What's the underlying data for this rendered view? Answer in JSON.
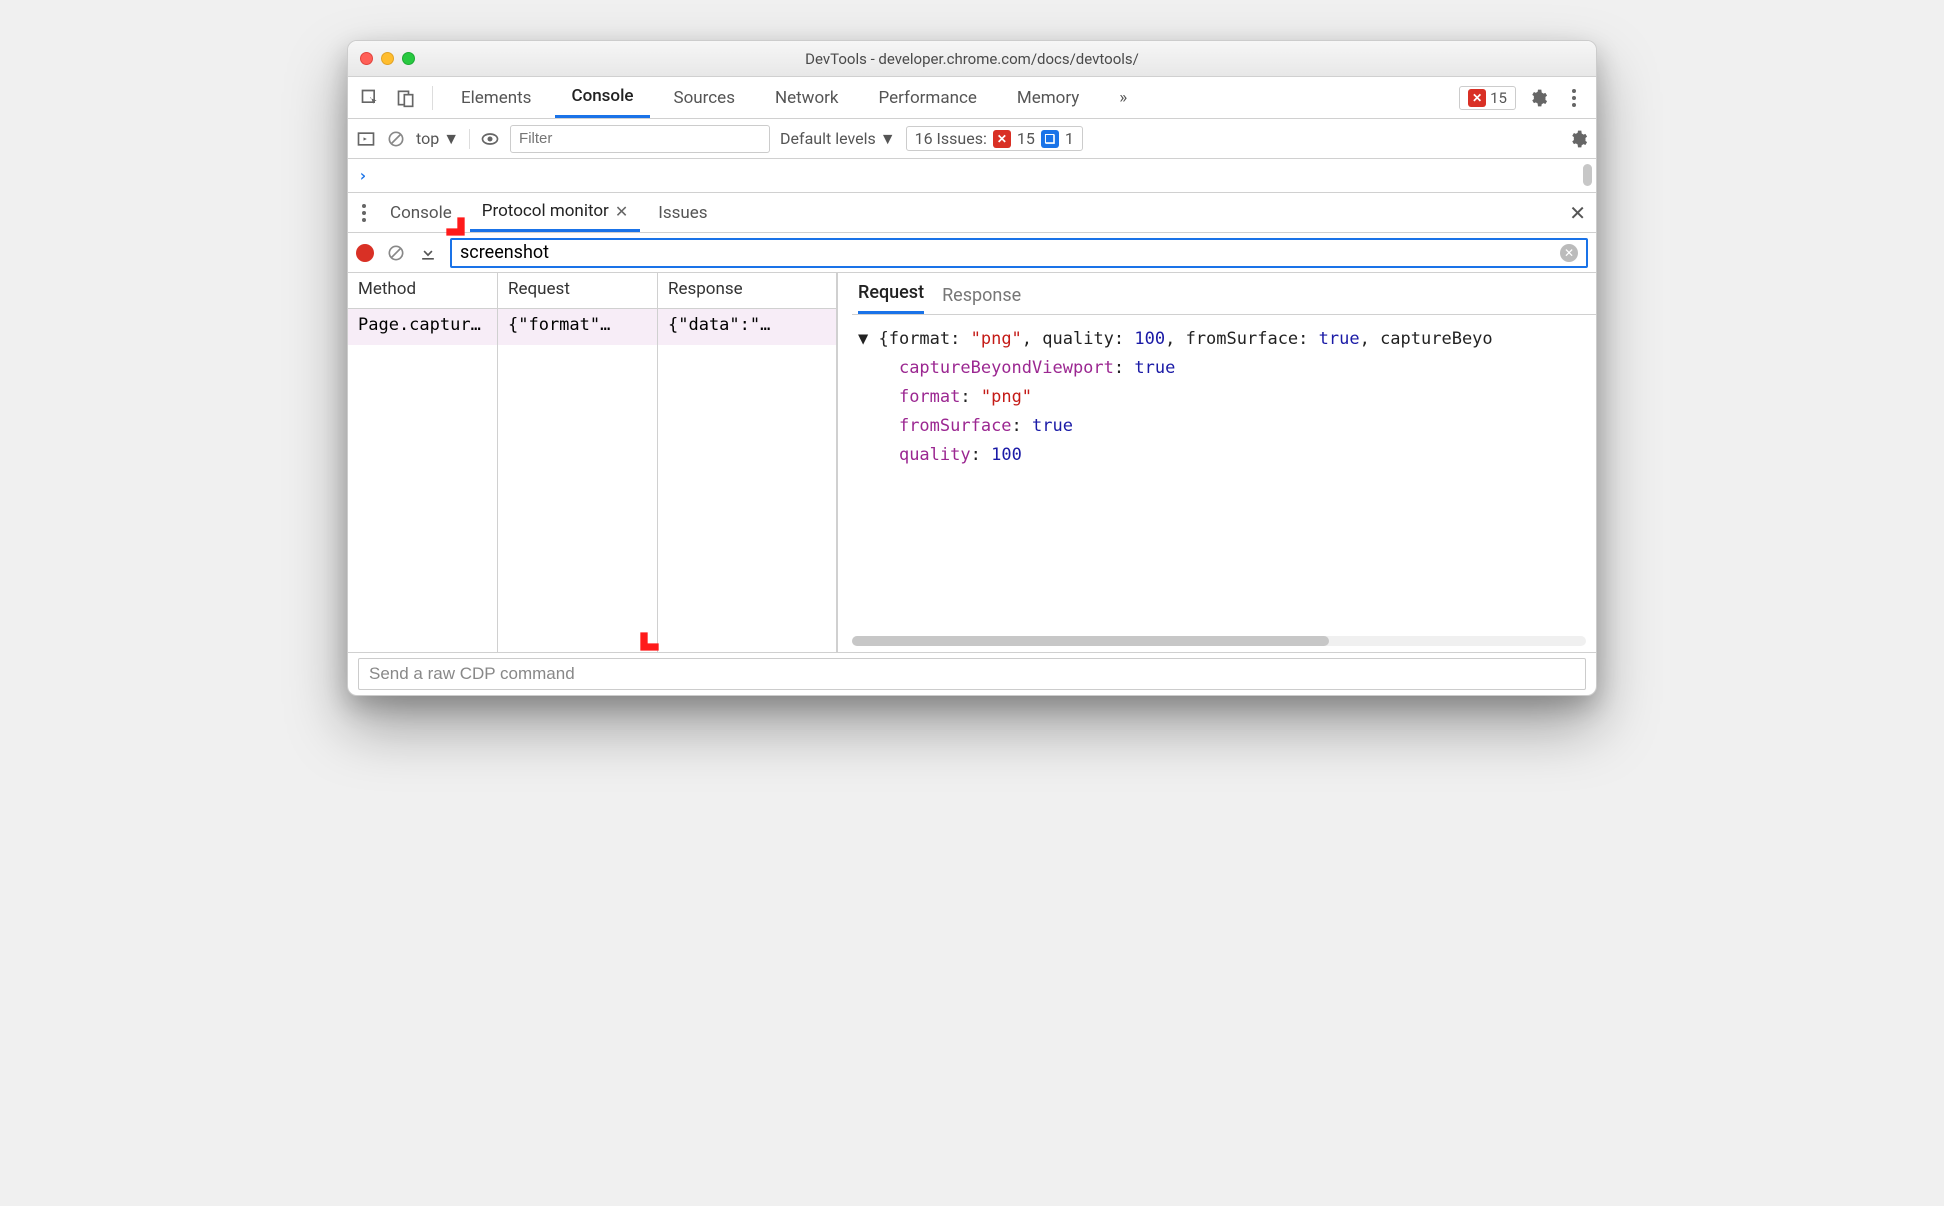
{
  "window": {
    "title": "DevTools - developer.chrome.com/docs/devtools/"
  },
  "top_tabs": {
    "elements": "Elements",
    "console": "Console",
    "sources": "Sources",
    "network": "Network",
    "performance": "Performance",
    "memory": "Memory",
    "more": "»",
    "error_count": "15"
  },
  "console_toolbar": {
    "context": "top",
    "filter_placeholder": "Filter",
    "levels": "Default levels",
    "issues_label": "16 Issues:",
    "issues_err": "15",
    "issues_info": "1"
  },
  "console_prompt": {
    "chevron": "›"
  },
  "drawer": {
    "console": "Console",
    "protocol": "Protocol monitor",
    "issues": "Issues"
  },
  "pm": {
    "filter_value": "screenshot",
    "headers": {
      "method": "Method",
      "request": "Request",
      "response": "Response"
    },
    "rows": [
      {
        "method": "Page.captur…",
        "request": "{\"format\"…",
        "response": "{\"data\":\"…"
      }
    ],
    "detail_tabs": {
      "request": "Request",
      "response": "Response"
    },
    "json": {
      "summary_prefix": "{format: ",
      "summary_png": "\"png\"",
      "summary_mid1": ", quality: ",
      "summary_q": "100",
      "summary_mid2": ", fromSurface: ",
      "summary_fs": "true",
      "summary_mid3": ", captureBeyo",
      "k_captureBeyondViewport": "captureBeyondViewport",
      "v_captureBeyondViewport": "true",
      "k_format": "format",
      "v_format": "\"png\"",
      "k_fromSurface": "fromSurface",
      "v_fromSurface": "true",
      "k_quality": "quality",
      "v_quality": "100"
    },
    "cdp_placeholder": "Send a raw CDP command"
  }
}
